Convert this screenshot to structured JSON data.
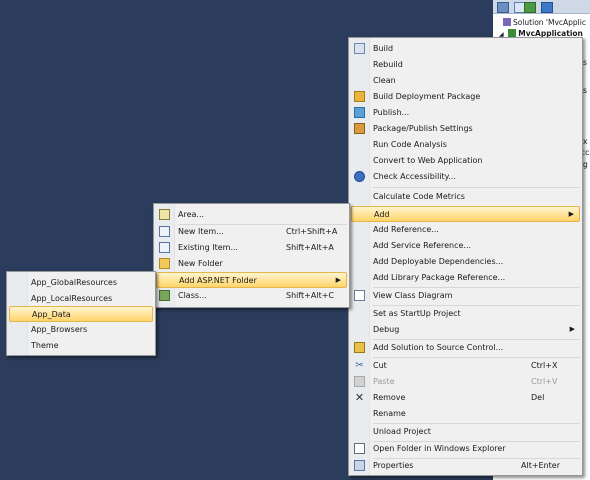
{
  "solution_explorer": {
    "tree": [
      "Solution 'MvcApplic",
      "MvcApplication"
    ],
    "fragments": [
      "s",
      "s",
      "x",
      "cc",
      "g"
    ]
  },
  "main_menu": {
    "items": [
      {
        "label": "Build",
        "icon": "build-icon"
      },
      {
        "label": "Rebuild"
      },
      {
        "label": "Clean"
      },
      {
        "label": "Build Deployment Package",
        "icon": "package-icon"
      },
      {
        "label": "Publish...",
        "icon": "publish-icon"
      },
      {
        "label": "Package/Publish Settings",
        "icon": "settings-icon"
      },
      {
        "label": "Run Code Analysis"
      },
      {
        "label": "Convert to Web Application"
      },
      {
        "label": "Check Accessibility...",
        "icon": "accessibility-icon"
      },
      {
        "label": "Calculate Code Metrics"
      },
      {
        "label": "Add"
      },
      {
        "label": "Add Reference..."
      },
      {
        "label": "Add Service Reference..."
      },
      {
        "label": "Add Deployable Dependencies..."
      },
      {
        "label": "Add Library Package Reference..."
      },
      {
        "label": "View Class Diagram",
        "icon": "class-diagram-icon"
      },
      {
        "label": "Set as StartUp Project"
      },
      {
        "label": "Debug"
      },
      {
        "label": "Add Solution to Source Control...",
        "icon": "source-control-icon"
      },
      {
        "label": "Cut",
        "shortcut": "Ctrl+X",
        "icon": "cut-icon"
      },
      {
        "label": "Paste",
        "shortcut": "Ctrl+V",
        "icon": "paste-icon"
      },
      {
        "label": "Remove",
        "shortcut": "Del",
        "icon": "remove-icon"
      },
      {
        "label": "Rename"
      },
      {
        "label": "Unload Project"
      },
      {
        "label": "Open Folder in Windows Explorer",
        "icon": "folder-open-icon"
      },
      {
        "label": "Properties",
        "shortcut": "Alt+Enter",
        "icon": "properties-icon"
      }
    ],
    "highlighted": "Add"
  },
  "add_menu": {
    "items": [
      {
        "label": "Area...",
        "icon": "area-icon"
      },
      {
        "label": "New Item...",
        "shortcut": "Ctrl+Shift+A",
        "icon": "new-item-icon"
      },
      {
        "label": "Existing Item...",
        "shortcut": "Shift+Alt+A",
        "icon": "existing-item-icon"
      },
      {
        "label": "New Folder",
        "icon": "new-folder-icon"
      },
      {
        "label": "Add ASP.NET Folder"
      },
      {
        "label": "Class...",
        "shortcut": "Shift+Alt+C",
        "icon": "class-icon"
      }
    ],
    "highlighted": "Add ASP.NET Folder"
  },
  "aspnet_folder_menu": {
    "items": [
      {
        "label": "App_GlobalResources"
      },
      {
        "label": "App_LocalResources"
      },
      {
        "label": "App_Data"
      },
      {
        "label": "App_Browsers"
      },
      {
        "label": "Theme"
      }
    ],
    "highlighted": "App_Data"
  }
}
